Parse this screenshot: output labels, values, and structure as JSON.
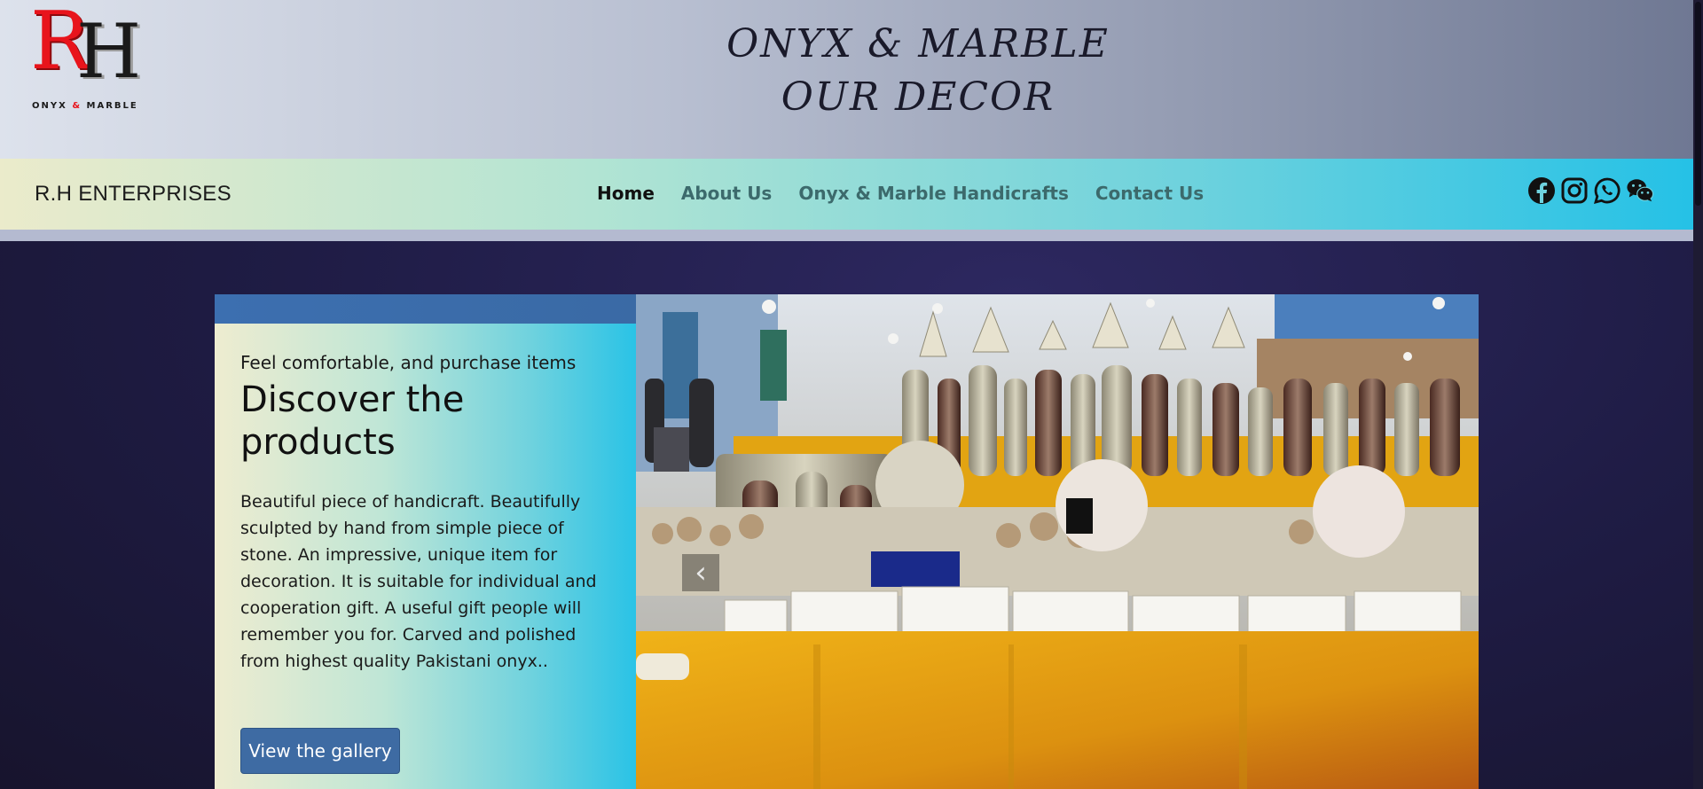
{
  "header": {
    "logo_letters": "RH",
    "logo_sub_left": "ONYX",
    "logo_sub_amp": "&",
    "logo_sub_right": "MARBLE",
    "title_line1": "ONYX & MARBLE",
    "title_line2": "OUR DECOR"
  },
  "nav": {
    "brand": "R.H ENTERPRISES",
    "links": [
      {
        "label": "Home",
        "active": true
      },
      {
        "label": "About Us",
        "active": false
      },
      {
        "label": "Onyx & Marble Handicrafts",
        "active": false
      },
      {
        "label": "Contact Us",
        "active": false
      }
    ],
    "socials": [
      "facebook-icon",
      "instagram-icon",
      "whatsapp-icon",
      "wechat-icon"
    ]
  },
  "hero": {
    "kicker": "Feel comfortable, and purchase items",
    "headline": "Discover the products",
    "description": "Beautiful piece of handicraft. Beautifully sculpted by hand from simple piece of stone. An impressive, unique item for decoration. It is suitable for individual and cooperation gift. A useful gift people will remember you for. Carved and polished from highest quality Pakistani onyx..",
    "button_label": "View the gallery",
    "prev_glyph": "‹"
  },
  "colors": {
    "logo_red": "#e8141c",
    "button_blue": "#3e6ba3",
    "nav_text": "#3c6a6c",
    "tablecloth": "#e5a10d"
  }
}
